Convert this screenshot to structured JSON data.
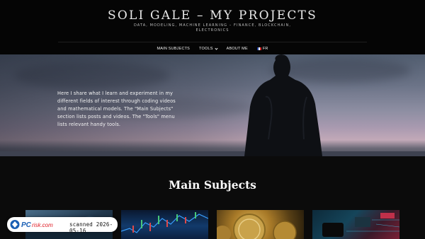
{
  "header": {
    "site_title": "SOLI GALE – MY PROJECTS",
    "tagline": "DATA, MODELING, MACHINE LEARNING – FINANCE, BLOCKCHAIN, ELECTRONICS"
  },
  "nav": {
    "items": [
      {
        "label": "MAIN SUBJECTS"
      },
      {
        "label": "TOOLS",
        "icon": "chevron-down-icon"
      },
      {
        "label": "ABOUT ME"
      },
      {
        "label": "FR",
        "icon": "french-flag-icon"
      }
    ]
  },
  "hero": {
    "text": "Here I share what I learn and experiment in my different fields of interest through coding videos and mathematical models. The \"Main Subjects\" section lists posts and videos. The \"Tools\" menu lists relevant handy tools."
  },
  "main": {
    "section_title": "Main Subjects"
  },
  "badge": {
    "logo_text": "PCrisk.com",
    "scanned_text": "scanned 2026-05-16",
    "colors": {
      "logo_blue": "#1a5fb4",
      "logo_red": "#e01b24"
    }
  }
}
